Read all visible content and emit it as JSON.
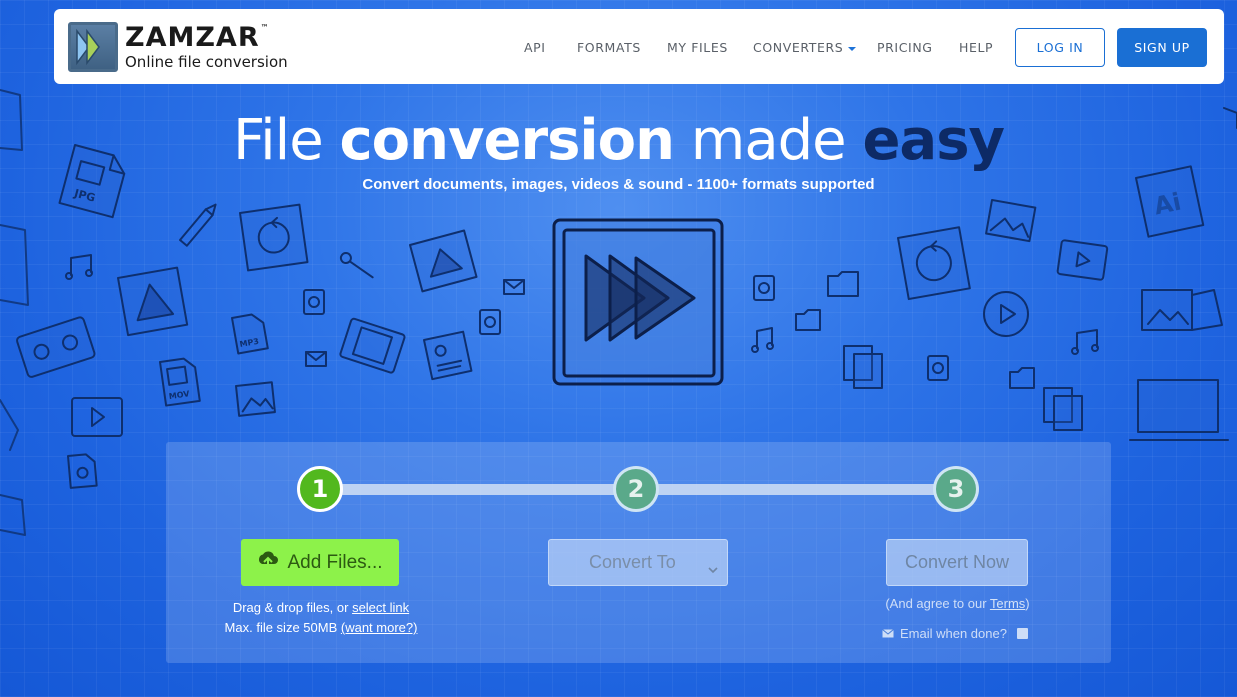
{
  "brand": {
    "name": "ZAMZAR",
    "trademark": "™",
    "tagline": "Online file conversion"
  },
  "nav": {
    "items": [
      "API",
      "FORMATS",
      "MY FILES",
      "CONVERTERS",
      "PRICING",
      "HELP"
    ],
    "login": "LOG IN",
    "signup": "SIGN UP"
  },
  "hero": {
    "title_part1": "File ",
    "title_part2": "conversion",
    "title_part3": " made ",
    "title_part4": "easy",
    "subtitle": "Convert documents, images, videos & sound - 1100+ formats supported"
  },
  "steps": {
    "step1": "1",
    "step2": "2",
    "step3": "3",
    "add_files": "Add Files...",
    "drag_text": "Drag & drop files, or ",
    "select_link": "select link",
    "max_size": "Max. file size 50MB ",
    "want_more": "(want more?)",
    "convert_to": "Convert To",
    "convert_now": "Convert Now",
    "agree_prefix": "(And agree to our ",
    "terms": "Terms",
    "agree_suffix": ")",
    "email_when_done": "Email when done?"
  },
  "colors": {
    "background": "#2f75e8",
    "brand_blue": "#1a6fd4",
    "step_active": "#52b81e",
    "add_button": "#8df24a",
    "easy_text": "#0d2a66"
  },
  "doodle_labels": {
    "jpg": "JPG",
    "mp3": "MP3",
    "mov": "MOV",
    "ai": "Ai"
  }
}
